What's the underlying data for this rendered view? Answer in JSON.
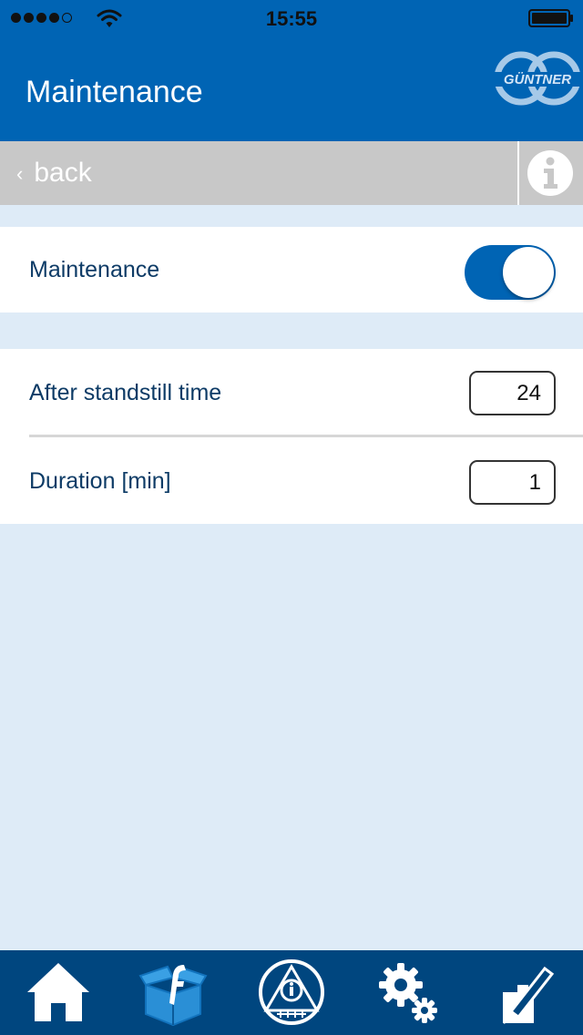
{
  "status_bar": {
    "time": "15:55",
    "signal_bars": 4,
    "signal_bars_total": 5,
    "icons": [
      "signal-dots-icon",
      "wifi-icon",
      "battery-icon"
    ]
  },
  "header": {
    "title": "Maintenance",
    "logo_text": "GÜNTNER",
    "background": "#0064b4"
  },
  "subheader": {
    "back_label": "back",
    "back_chevron": "‹",
    "info_icon": "info-icon"
  },
  "settings": {
    "maintenance": {
      "label": "Maintenance",
      "enabled": true
    },
    "standstill": {
      "label": "After standstill time",
      "value": "24"
    },
    "duration": {
      "label": "Duration [min]",
      "value": "1"
    }
  },
  "tab_bar": {
    "tabs": [
      {
        "icon": "home-icon"
      },
      {
        "icon": "facebook-box-icon"
      },
      {
        "icon": "info-triangle-icon"
      },
      {
        "icon": "gears-icon"
      },
      {
        "icon": "edit-pen-icon"
      }
    ]
  },
  "colors": {
    "primary": "#0064b4",
    "tabbar": "#00467f",
    "page_background": "#deebf7",
    "subheader": "#c8c8c8",
    "label_text": "#0d3b66"
  }
}
